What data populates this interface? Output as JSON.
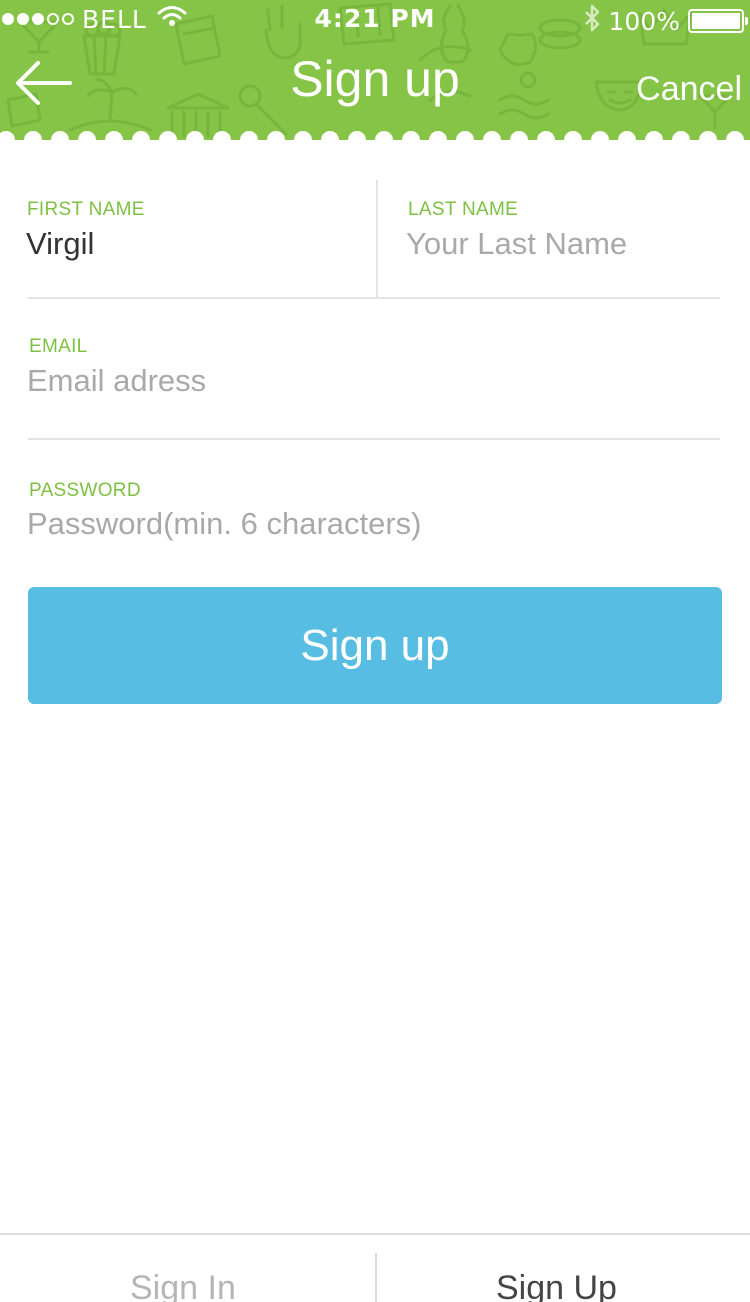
{
  "status_bar": {
    "carrier": "BELL",
    "time": "4:21 PM",
    "battery": "100%",
    "signal_bars_filled": 3,
    "signal_bars_total": 5
  },
  "nav": {
    "title": "Sign up",
    "cancel_label": "Cancel",
    "back_icon": "arrow-left-icon"
  },
  "form": {
    "first_name": {
      "label": "FIRST NAME",
      "value": "Virgil"
    },
    "last_name": {
      "label": "LAST NAME",
      "placeholder": "Your Last Name"
    },
    "email": {
      "label": "EMAIL",
      "placeholder": "Email adress"
    },
    "password": {
      "label": "PASSWORD",
      "placeholder": "Password(min. 6 characters)"
    },
    "submit_label": "Sign up"
  },
  "tabs": {
    "signin_label": "Sign In",
    "signup_label": "Sign Up",
    "active": "Sign Up"
  },
  "colors": {
    "header_green": "#85c446",
    "label_green": "#7ec043",
    "button_blue": "#58bde3"
  }
}
